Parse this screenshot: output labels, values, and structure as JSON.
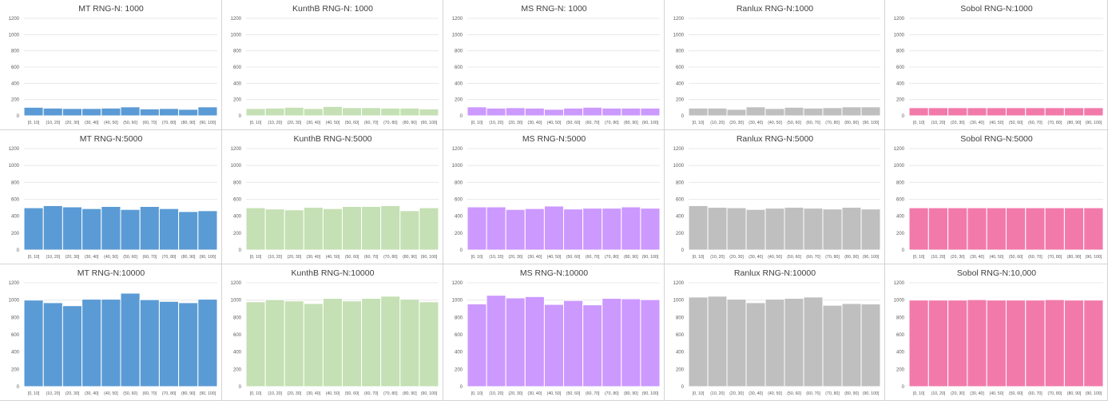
{
  "colors": {
    "MT": "#5b9bd5",
    "KunthB": "#c5e0b4",
    "MS": "#cc99ff",
    "Ranlux": "#bfbfbf",
    "Sobol": "#f27aab"
  },
  "chart_data": [
    {
      "type": "bar",
      "title": "MT RNG-N: 1000",
      "color_key": "MT",
      "categories": [
        "[0, 10]",
        "(10, 20]",
        "(20, 30]",
        "(30, 40]",
        "(40, 50]",
        "(50, 60]",
        "(60, 70]",
        "(70, 80]",
        "(80, 90]",
        "(90, 100]"
      ],
      "values": [
        105,
        95,
        90,
        90,
        95,
        110,
        85,
        90,
        80,
        110
      ],
      "ylim": [
        0,
        1200
      ],
      "yticks": [
        0,
        200,
        400,
        600,
        800,
        1000,
        1200
      ]
    },
    {
      "type": "bar",
      "title": "KunthB RNG-N: 1000",
      "color_key": "KunthB",
      "categories": [
        "[0, 10]",
        "(10, 20]",
        "(20, 30]",
        "(30, 40]",
        "(40, 50]",
        "(50, 60]",
        "(60, 70]",
        "(70, 80]",
        "(80, 90]",
        "(90, 100]"
      ],
      "values": [
        90,
        95,
        105,
        90,
        115,
        100,
        100,
        95,
        95,
        85
      ],
      "ylim": [
        0,
        1200
      ],
      "yticks": [
        0,
        200,
        400,
        600,
        800,
        1000,
        1200
      ]
    },
    {
      "type": "bar",
      "title": "MS RNG-N: 1000",
      "color_key": "MS",
      "categories": [
        "[0, 10]",
        "(10, 20]",
        "(20, 30]",
        "(30, 40]",
        "(40, 50]",
        "(50, 60]",
        "(60, 70]",
        "(70, 80]",
        "(80, 90]",
        "(90, 100]"
      ],
      "values": [
        110,
        95,
        100,
        95,
        80,
        95,
        105,
        95,
        95,
        95
      ],
      "ylim": [
        0,
        1200
      ],
      "yticks": [
        0,
        200,
        400,
        600,
        800,
        1000,
        1200
      ]
    },
    {
      "type": "bar",
      "title": "Ranlux RNG-N:1000",
      "color_key": "Ranlux",
      "categories": [
        "[0, 10]",
        "(10, 20]",
        "(20, 30]",
        "(30, 40]",
        "(40, 50]",
        "(50, 60]",
        "(60, 70]",
        "(70, 80]",
        "(80, 90]",
        "(90, 100]"
      ],
      "values": [
        95,
        95,
        80,
        110,
        90,
        105,
        95,
        100,
        110,
        110
      ],
      "ylim": [
        0,
        1200
      ],
      "yticks": [
        0,
        200,
        400,
        600,
        800,
        1000,
        1200
      ]
    },
    {
      "type": "bar",
      "title": "Sobol RNG-N:1000",
      "color_key": "Sobol",
      "categories": [
        "[0, 10]",
        "(10, 20]",
        "(20, 30]",
        "(30, 40]",
        "(40, 50]",
        "(50, 60]",
        "(60, 70]",
        "(70, 80]",
        "(80, 90]",
        "(90, 100]"
      ],
      "values": [
        100,
        100,
        100,
        100,
        100,
        100,
        100,
        100,
        100,
        100
      ],
      "ylim": [
        0,
        1200
      ],
      "yticks": [
        0,
        200,
        400,
        600,
        800,
        1000,
        1200
      ]
    },
    {
      "type": "bar",
      "title": "MT RNG-N:5000",
      "color_key": "MT",
      "categories": [
        "[0, 10]",
        "(10, 20]",
        "(20, 30]",
        "(30, 40]",
        "(40, 50]",
        "(50, 60]",
        "(60, 70]",
        "(70, 80]",
        "(80, 90]",
        "(90, 100]"
      ],
      "values": [
        500,
        525,
        510,
        490,
        515,
        480,
        515,
        490,
        455,
        465
      ],
      "ylim": [
        0,
        1200
      ],
      "yticks": [
        0,
        200,
        400,
        600,
        800,
        1000,
        1200
      ]
    },
    {
      "type": "bar",
      "title": "KunthB RNG-N:5000",
      "color_key": "KunthB",
      "categories": [
        "[0, 10]",
        "(10, 20]",
        "(20, 30]",
        "(30, 40]",
        "(40, 50]",
        "(50, 60]",
        "(60, 70]",
        "(70, 80]",
        "(80, 90]",
        "(90, 100]"
      ],
      "values": [
        500,
        485,
        475,
        505,
        490,
        515,
        515,
        525,
        465,
        500
      ],
      "ylim": [
        0,
        1200
      ],
      "yticks": [
        0,
        200,
        400,
        600,
        800,
        1000,
        1200
      ]
    },
    {
      "type": "bar",
      "title": "MS RNG-N:5000",
      "color_key": "MS",
      "categories": [
        "[0, 10]",
        "(10, 20]",
        "(20, 30]",
        "(30, 40]",
        "(40, 50]",
        "(50, 60]",
        "(60, 70]",
        "(70, 80]",
        "(80, 90]",
        "(90, 100]"
      ],
      "values": [
        510,
        510,
        480,
        490,
        520,
        485,
        495,
        495,
        510,
        495
      ],
      "ylim": [
        0,
        1200
      ],
      "yticks": [
        0,
        200,
        400,
        600,
        800,
        1000,
        1200
      ]
    },
    {
      "type": "bar",
      "title": "Ranlux RNG-N:5000",
      "color_key": "Ranlux",
      "categories": [
        "[0, 10]",
        "(10, 20]",
        "(20, 30]",
        "(30, 40]",
        "(40, 50]",
        "(50, 60]",
        "(60, 70]",
        "(70, 80]",
        "(80, 90]",
        "(90, 100]"
      ],
      "values": [
        525,
        505,
        500,
        480,
        495,
        505,
        495,
        485,
        505,
        485
      ],
      "ylim": [
        0,
        1200
      ],
      "yticks": [
        0,
        200,
        400,
        600,
        800,
        1000,
        1200
      ]
    },
    {
      "type": "bar",
      "title": "Sobol RNG-N:5000",
      "color_key": "Sobol",
      "categories": [
        "[0, 10]",
        "(10, 20]",
        "(20, 30]",
        "(30, 40]",
        "(40, 50]",
        "(50, 60]",
        "(60, 70]",
        "(70, 80]",
        "(80, 90]",
        "(90, 100]"
      ],
      "values": [
        500,
        500,
        500,
        500,
        500,
        500,
        500,
        500,
        500,
        500
      ],
      "ylim": [
        0,
        1200
      ],
      "yticks": [
        0,
        200,
        400,
        600,
        800,
        1000,
        1200
      ]
    },
    {
      "type": "bar",
      "title": "MT RNG-N:10000",
      "color_key": "MT",
      "categories": [
        "[0, 10]",
        "(10, 20]",
        "(20, 30]",
        "(30, 40]",
        "(40, 50]",
        "(50, 60]",
        "(60, 70]",
        "(70, 80]",
        "(80, 90]",
        "(90, 100]"
      ],
      "values": [
        1000,
        970,
        935,
        1010,
        1010,
        1080,
        1005,
        985,
        970,
        1010
      ],
      "ylim": [
        0,
        1200
      ],
      "yticks": [
        0,
        200,
        400,
        600,
        800,
        1000,
        1200
      ]
    },
    {
      "type": "bar",
      "title": "KunthB RNG-N:10000",
      "color_key": "KunthB",
      "categories": [
        "[0, 10]",
        "(10, 20]",
        "(20, 30]",
        "(30, 40]",
        "(40, 50]",
        "(50, 60]",
        "(60, 70]",
        "(70, 80]",
        "(80, 90]",
        "(90, 100]"
      ],
      "values": [
        980,
        1005,
        990,
        960,
        1020,
        990,
        1020,
        1045,
        1010,
        980
      ],
      "ylim": [
        0,
        1200
      ],
      "yticks": [
        0,
        200,
        400,
        600,
        800,
        1000,
        1200
      ]
    },
    {
      "type": "bar",
      "title": "MS RNG-N:10000",
      "color_key": "MS",
      "categories": [
        "[0, 10]",
        "(10, 20]",
        "(20, 30]",
        "(30, 40]",
        "(40, 50]",
        "(50, 60]",
        "(60, 70]",
        "(70, 80]",
        "(80, 90]",
        "(90, 100]"
      ],
      "values": [
        955,
        1055,
        1025,
        1040,
        950,
        995,
        945,
        1020,
        1015,
        1005
      ],
      "ylim": [
        0,
        1200
      ],
      "yticks": [
        0,
        200,
        400,
        600,
        800,
        1000,
        1200
      ]
    },
    {
      "type": "bar",
      "title": "Ranlux RNG-N:10000",
      "color_key": "Ranlux",
      "categories": [
        "[0, 10]",
        "(10, 20]",
        "(20, 30]",
        "(30, 40]",
        "(40, 50]",
        "(50, 60]",
        "(60, 70]",
        "(70, 80]",
        "(80, 90]",
        "(90, 100]"
      ],
      "values": [
        1035,
        1045,
        1010,
        970,
        1010,
        1020,
        1035,
        940,
        960,
        955
      ],
      "ylim": [
        0,
        1200
      ],
      "yticks": [
        0,
        200,
        400,
        600,
        800,
        1000,
        1200
      ]
    },
    {
      "type": "bar",
      "title": "Sobol RNG-N:10,000",
      "color_key": "Sobol",
      "categories": [
        "[0, 10]",
        "(10, 20]",
        "(20, 30]",
        "(30, 40]",
        "(40, 50]",
        "(50, 60]",
        "(60, 70]",
        "(70, 80]",
        "(80, 90]",
        "(90, 100]"
      ],
      "values": [
        1000,
        1000,
        1000,
        1005,
        1000,
        1000,
        1000,
        1005,
        1000,
        1000
      ],
      "ylim": [
        0,
        1200
      ],
      "yticks": [
        0,
        200,
        400,
        600,
        800,
        1000,
        1200
      ]
    }
  ]
}
